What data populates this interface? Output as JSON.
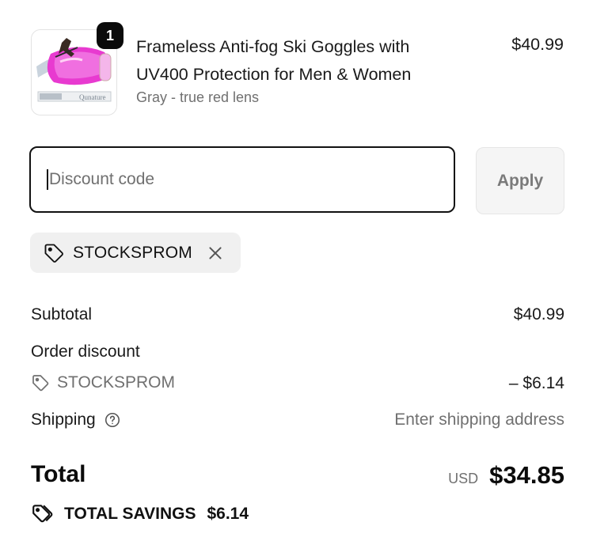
{
  "product": {
    "quantity": "1",
    "title_line1": "Frameless Anti-fog Ski Goggles with",
    "title_line2": "UV400 Protection for Men & Women",
    "variant": "Gray - true red lens",
    "price": "$40.99",
    "image_brand_text": "Qunature"
  },
  "discount": {
    "placeholder": "Discount code",
    "apply_label": "Apply",
    "applied_code": "STOCKSPROM"
  },
  "summary": {
    "subtotal_label": "Subtotal",
    "subtotal_value": "$40.99",
    "order_discount_label": "Order discount",
    "order_discount_code": "STOCKSPROM",
    "order_discount_value": "– $6.14",
    "shipping_label": "Shipping",
    "shipping_value": "Enter shipping address",
    "total_label": "Total",
    "currency": "USD",
    "total_value": "$34.85",
    "savings_label": "TOTAL SAVINGS",
    "savings_value": "$6.14"
  },
  "colors": {
    "text": "#1a1a1a",
    "muted": "#707070",
    "chip_bg": "#f0f0f0",
    "apply_bg": "#f5f5f5",
    "badge_bg": "#0b0b0b"
  }
}
